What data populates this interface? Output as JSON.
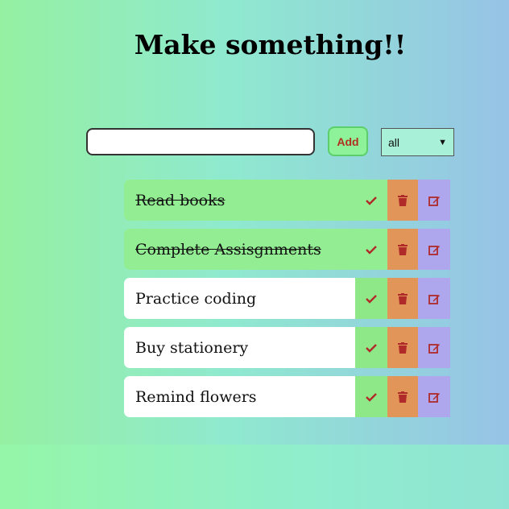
{
  "header": {
    "title": "Make something!!"
  },
  "form": {
    "input_value": "",
    "add_label": "Add",
    "filter_selected": "all"
  },
  "todos": [
    {
      "text": "Read books",
      "completed": true
    },
    {
      "text": "Complete Assisgnments",
      "completed": true
    },
    {
      "text": "Practice coding",
      "completed": false
    },
    {
      "text": "Buy stationery",
      "completed": false
    },
    {
      "text": "Remind flowers",
      "completed": false
    }
  ],
  "icons": {
    "check": "check-icon",
    "trash": "trash-icon",
    "edit": "edit-icon"
  },
  "colors": {
    "completed_bg": "#93ee93",
    "check_bg": "#8fe887",
    "trash_bg": "#e29558",
    "edit_bg": "#aea7ed",
    "icon_color": "#b12a2a"
  }
}
